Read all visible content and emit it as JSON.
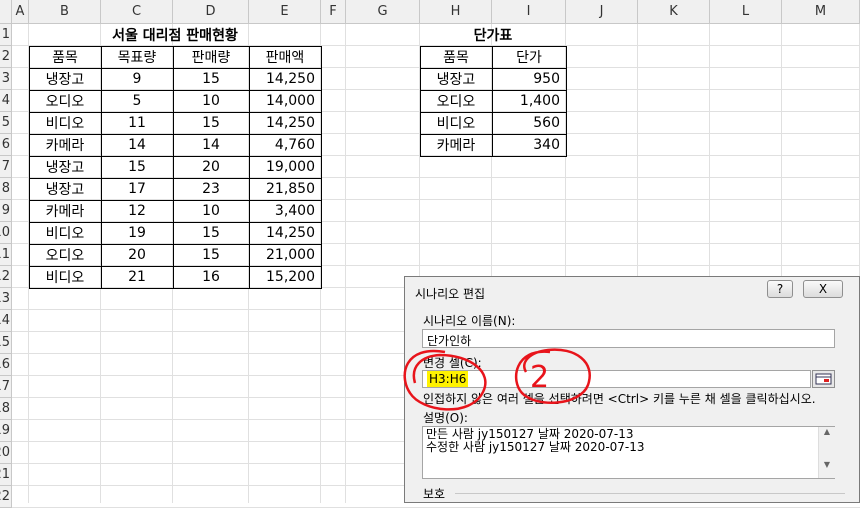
{
  "columns": [
    "A",
    "B",
    "C",
    "D",
    "E",
    "F",
    "G",
    "H",
    "I",
    "J",
    "K",
    "L",
    "M"
  ],
  "rows": [
    "1",
    "2",
    "3",
    "4",
    "5",
    "6",
    "7",
    "8",
    "9",
    "10",
    "11",
    "12",
    "13",
    "14",
    "15",
    "16",
    "17",
    "18",
    "19",
    "20",
    "21",
    "22"
  ],
  "sales": {
    "title": "서울 대리점 판매현황",
    "headers": [
      "품목",
      "목표량",
      "판매량",
      "판매액"
    ],
    "rows": [
      [
        "냉장고",
        "9",
        "15",
        "14,250"
      ],
      [
        "오디오",
        "5",
        "10",
        "14,000"
      ],
      [
        "비디오",
        "11",
        "15",
        "14,250"
      ],
      [
        "카메라",
        "14",
        "14",
        "4,760"
      ],
      [
        "냉장고",
        "15",
        "20",
        "19,000"
      ],
      [
        "냉장고",
        "17",
        "23",
        "21,850"
      ],
      [
        "카메라",
        "12",
        "10",
        "3,400"
      ],
      [
        "비디오",
        "19",
        "15",
        "14,250"
      ],
      [
        "오디오",
        "20",
        "15",
        "21,000"
      ],
      [
        "비디오",
        "21",
        "16",
        "15,200"
      ]
    ]
  },
  "price": {
    "title": "단가표",
    "headers": [
      "품목",
      "단가"
    ],
    "rows": [
      [
        "냉장고",
        "950"
      ],
      [
        "오디오",
        "1,400"
      ],
      [
        "비디오",
        "560"
      ],
      [
        "카메라",
        "340"
      ]
    ]
  },
  "dialog": {
    "title": "시나리오 편집",
    "help_btn": "?",
    "close_btn": "X",
    "name_label": "시나리오 이름(N):",
    "name_value": "단가인하",
    "cells_label": "변경 셀(C):",
    "cells_value": "H3:H6",
    "hint": "인접하지 않은 여러 셀을 선택하려면 <Ctrl> 키를 누른 채 셀을 클릭하십시오.",
    "desc_label": "설명(O):",
    "desc_line1": "만든 사람 jy150127 날짜 2020-07-13",
    "desc_line2": "수정한 사람 jy150127 날짜 2020-07-13",
    "protect_label": "보호"
  },
  "annotation": {
    "text": "2",
    "color": "#e8141b"
  }
}
